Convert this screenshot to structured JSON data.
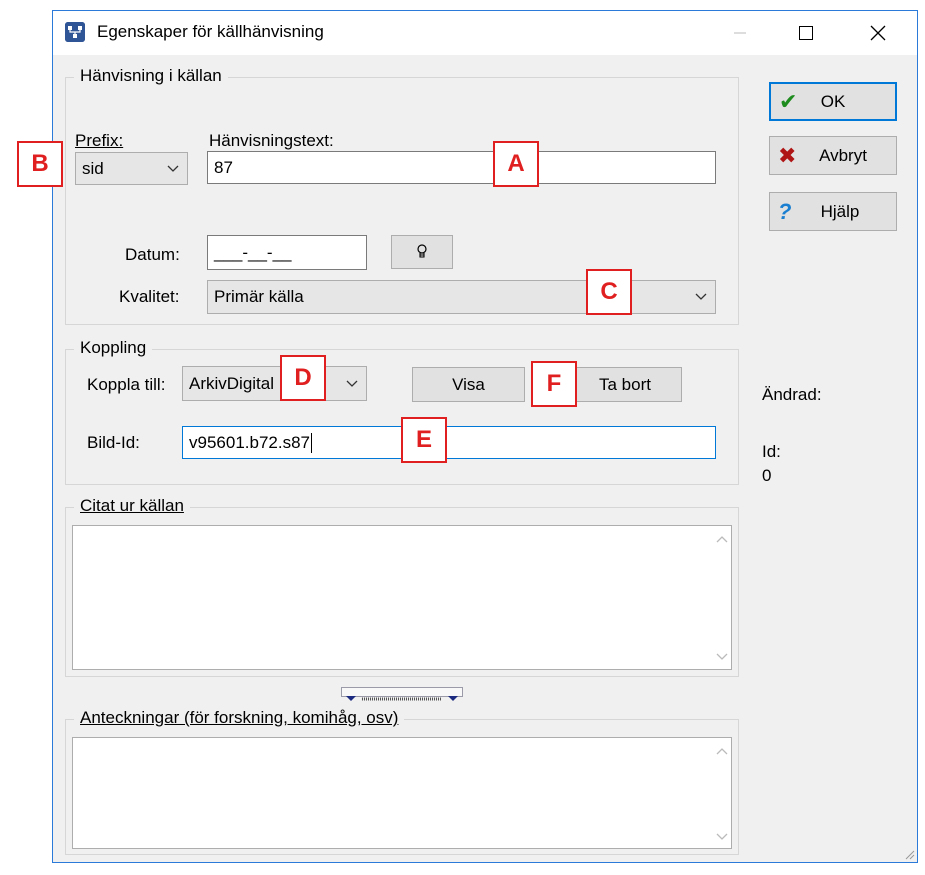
{
  "window": {
    "title": "Egenskaper för källhänvisning",
    "icon": "family-tree-icon"
  },
  "groups": {
    "hanvisning": "Hänvisning i källan",
    "koppling": "Koppling",
    "citat": "Citat ur källan",
    "anteckningar": "Anteckningar (för forskning, komihåg, osv)"
  },
  "fields": {
    "prefix_label": "Prefix:",
    "prefix_value": "sid",
    "hanvisningstext_label": "Hänvisningstext:",
    "hanvisningstext_value": "87",
    "datum_label": "Datum:",
    "datum_value": "___-__-__",
    "kvalitet_label": "Kvalitet:",
    "kvalitet_value": "Primär källa",
    "koppla_label": "Koppla till:",
    "koppla_value": "ArkivDigital",
    "bildid_label": "Bild-Id:",
    "bildid_value": "v95601.b72.s87"
  },
  "buttons": {
    "ok": "OK",
    "avbryt": "Avbryt",
    "hjalp": "Hjälp",
    "visa": "Visa",
    "ta_bort": "Ta bort"
  },
  "info": {
    "andrad_label": "Ändrad:",
    "id_label": "Id:",
    "id_value": "0"
  },
  "callouts": [
    "A",
    "B",
    "C",
    "D",
    "E",
    "F"
  ],
  "colors": {
    "callout": "#e02020",
    "window_border": "#2b79d8",
    "dialog_bg": "#f0f0f0",
    "focus_border": "#0078d7",
    "ok_check": "#1e8b1e",
    "cancel_x": "#b01515",
    "help_q": "#1a7fd0"
  }
}
